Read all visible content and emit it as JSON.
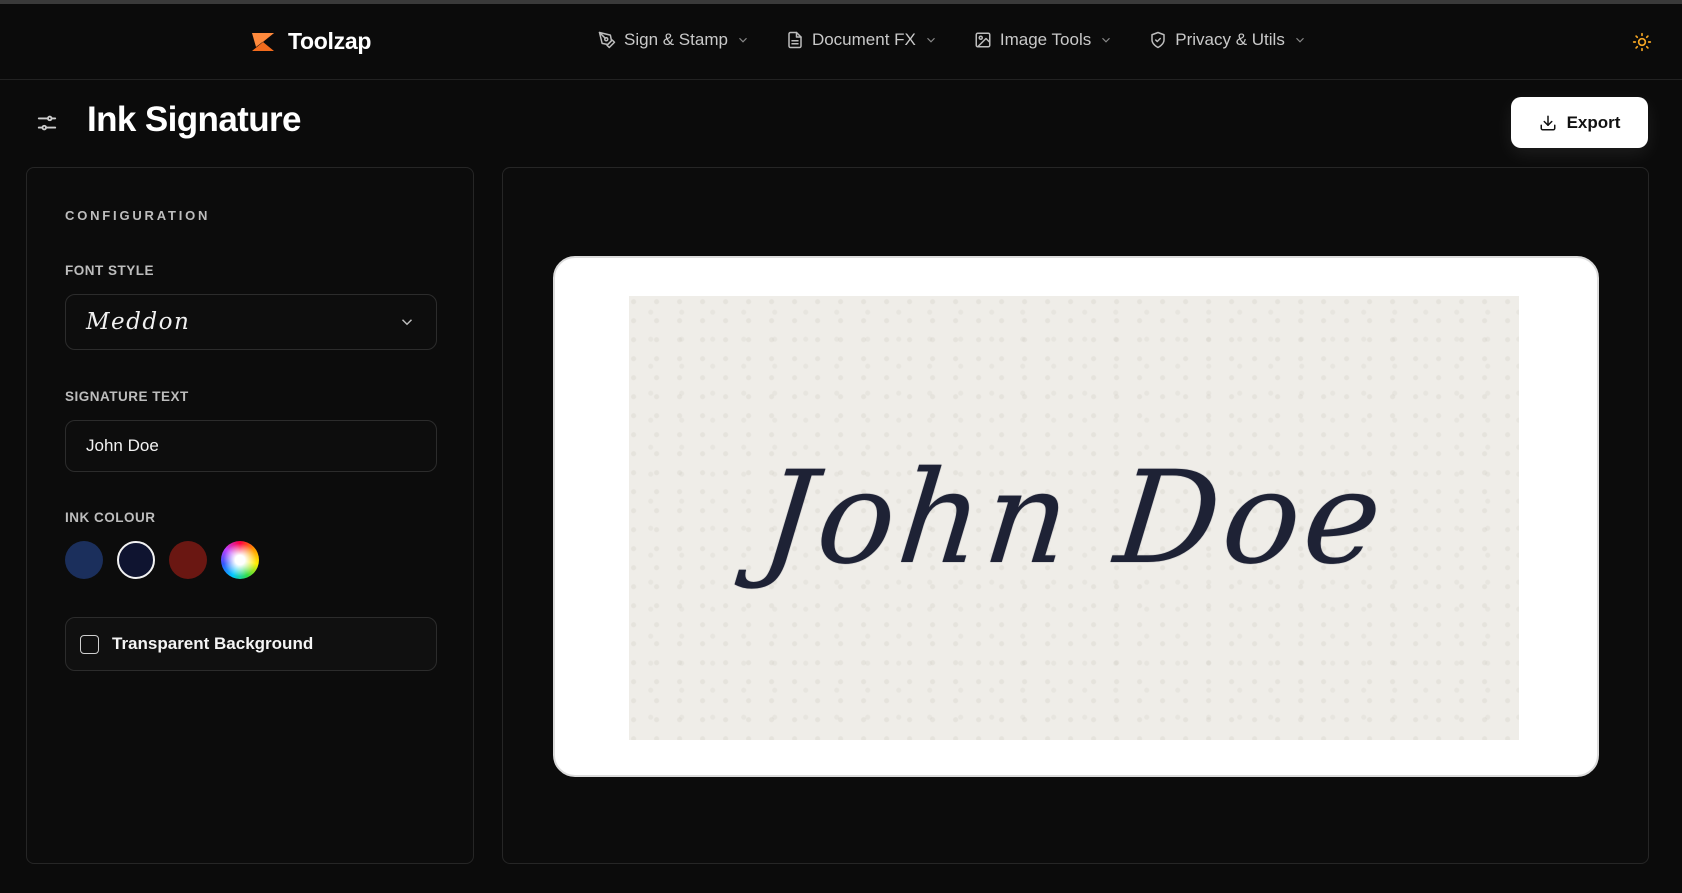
{
  "brand": {
    "name": "Toolzap",
    "accent": "#f26b1d"
  },
  "nav": [
    {
      "label": "Sign & Stamp",
      "icon": "pen-nib-icon"
    },
    {
      "label": "Document FX",
      "icon": "document-icon"
    },
    {
      "label": "Image Tools",
      "icon": "image-icon"
    },
    {
      "label": "Privacy & Utils",
      "icon": "shield-icon"
    }
  ],
  "page": {
    "title": "Ink Signature"
  },
  "export": {
    "label": "Export"
  },
  "config": {
    "title": "CONFIGURATION",
    "font_style": {
      "label": "FONT STYLE",
      "value": "Meddon"
    },
    "signature_text": {
      "label": "SIGNATURE TEXT",
      "value": "John Doe"
    },
    "ink_colour": {
      "label": "INK COLOUR",
      "swatches": [
        {
          "name": "navy",
          "color": "#1b2f5c",
          "selected": false
        },
        {
          "name": "midnight",
          "color": "#0f1430",
          "selected": true
        },
        {
          "name": "maroon",
          "color": "#6a1712",
          "selected": false
        },
        {
          "name": "custom",
          "color": "conic-rainbow",
          "selected": false
        }
      ]
    },
    "transparent_background": {
      "label": "Transparent Background",
      "checked": false
    }
  },
  "preview": {
    "signature": "John Doe",
    "ink_color": "#1e2235",
    "paper_color": "#efede8"
  }
}
